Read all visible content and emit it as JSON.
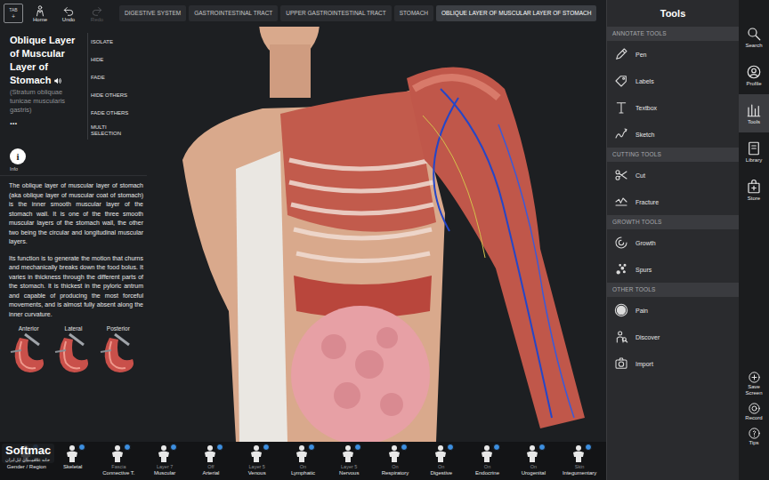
{
  "top_bar": {
    "tab_button": "TAB",
    "tab_plus": "+",
    "nav": [
      {
        "label": "Home",
        "disabled": false
      },
      {
        "label": "Undo",
        "disabled": false
      },
      {
        "label": "Redo",
        "disabled": true
      }
    ]
  },
  "breadcrumbs": [
    {
      "label": "DIGESTIVE SYSTEM",
      "selected": false
    },
    {
      "label": "GASTROINTESTINAL TRACT",
      "selected": false
    },
    {
      "label": "UPPER GASTROINTESTINAL TRACT",
      "selected": false
    },
    {
      "label": "STOMACH",
      "selected": false
    },
    {
      "label": "OBLIQUE LAYER OF MUSCULAR LAYER OF STOMACH",
      "selected": true
    }
  ],
  "structure": {
    "title": "Oblique Layer of Muscular Layer of Stomach",
    "latin_name": "(Stratum obliquae tunicae muscularis gastris)",
    "more": "...",
    "actions": [
      "ISOLATE",
      "HIDE",
      "FADE",
      "HIDE OTHERS",
      "FADE OTHERS",
      "MULTI SELECTION"
    ]
  },
  "info": {
    "icon": "i",
    "label": "Info",
    "paragraphs": [
      "The oblique layer of muscular layer of stomach (aka oblique layer of muscular coat of stomach) is the inner smooth muscular layer of the stomach wall. It is one of the three smooth muscular layers of the stomach wall, the other two being the circular and longitudinal muscular layers.",
      "Its function is to generate the motion that churns and mechanically breaks down the food bolus. It varies in thickness through the different parts of the stomach. It is thickest in the pyloric antrum and capable of producing the most forceful movements, and is almost fully absent along the inner curvature."
    ],
    "views": [
      "Anterior",
      "Lateral",
      "Posterior"
    ]
  },
  "tools": {
    "title": "Tools",
    "sections": [
      {
        "title": "ANNOTATE TOOLS",
        "items": [
          {
            "label": "Pen"
          },
          {
            "label": "Labels"
          },
          {
            "label": "Textbox"
          },
          {
            "label": "Sketch"
          }
        ]
      },
      {
        "title": "CUTTING TOOLS",
        "items": [
          {
            "label": "Cut"
          },
          {
            "label": "Fracture"
          }
        ]
      },
      {
        "title": "GROWTH TOOLS",
        "items": [
          {
            "label": "Growth"
          },
          {
            "label": "Spurs"
          }
        ]
      },
      {
        "title": "OTHER TOOLS",
        "items": [
          {
            "label": "Pain"
          },
          {
            "label": "Discover"
          },
          {
            "label": "Import"
          }
        ]
      }
    ]
  },
  "nav_rail": {
    "items": [
      {
        "label": "Search",
        "selected": false
      },
      {
        "label": "Profile",
        "selected": false
      },
      {
        "label": "Tools",
        "selected": true
      },
      {
        "label": "Library",
        "selected": false
      },
      {
        "label": "Store",
        "selected": false
      }
    ],
    "actions": [
      "Save Screen",
      "Record",
      "Tips"
    ]
  },
  "layers": [
    {
      "name": "Gender / Region"
    },
    {
      "name": "Skeletal"
    },
    {
      "status": "Fascia",
      "name": "Connective T."
    },
    {
      "status": "Layer 7",
      "name": "Muscular"
    },
    {
      "status": "Off",
      "name": "Arterial"
    },
    {
      "status": "Layer 5",
      "name": "Venous"
    },
    {
      "status": "On",
      "name": "Lymphatic"
    },
    {
      "status": "Layer 5",
      "name": "Nervous"
    },
    {
      "status": "On",
      "name": "Respiratory"
    },
    {
      "status": "On",
      "name": "Digestive"
    },
    {
      "status": "On",
      "name": "Endocrine"
    },
    {
      "status": "On",
      "name": "Urogenital"
    },
    {
      "status": "Skin",
      "name": "Integumentary"
    }
  ],
  "watermark": {
    "brand": "Softmac",
    "tagline": "خانه علاقمندان اپل ایران"
  }
}
